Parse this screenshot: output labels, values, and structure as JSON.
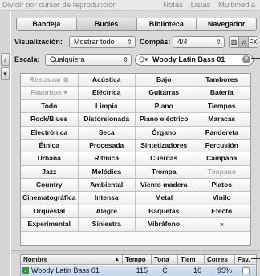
{
  "topbar": {
    "left_text": "Dividir por cursor de reproducción",
    "right_text": "Notas Listas Multimedia"
  },
  "tabs": [
    "Bandeja",
    "Bucles",
    "Biblioteca",
    "Navegador"
  ],
  "active_tab": "Bucles",
  "controls": {
    "view_label": "Visualización:",
    "view_value": "Mostrar todo",
    "time_label": "Compás:",
    "time_value": "4/4",
    "scale_label": "Escala:",
    "scale_value": "Cualquiera",
    "search_value": "Woody Latin Bass 01",
    "view_buttons": [
      "column-view-icon",
      "music-note-icon",
      "fx-icon"
    ],
    "fx_label": "FX"
  },
  "keywords": [
    "Restaurar",
    "Acústica",
    "Bajo",
    "Tambores",
    "Favoritos",
    "Eléctrica",
    "Guitarras",
    "Batería",
    "Todo",
    "Limpia",
    "Piano",
    "Tiempos",
    "Rock/Blues",
    "Distorsionada",
    "Piano eléctrico",
    "Maracas",
    "Electrónica",
    "Seca",
    "Órgano",
    "Pandereta",
    "Étnica",
    "Procesada",
    "Sintetizadores",
    "Percusión",
    "Urbana",
    "Rítmica",
    "Cuerdas",
    "Campana",
    "Jazz",
    "Melódica",
    "Trompa",
    "Tímpano",
    "Country",
    "Ambiental",
    "Viento madera",
    "Platos",
    "Cinematográfica",
    "Intensa",
    "Metal",
    "Vinilo",
    "Orquestal",
    "Alegre",
    "Baquetas",
    "Efecto",
    "Experimental",
    "Siniestra",
    "Vibráfono",
    "»"
  ],
  "dimmed_keywords": [
    "Restaurar",
    "Favoritos",
    "Tímpano"
  ],
  "table": {
    "headers": [
      "Nombre",
      "Tempo",
      "Tona",
      "Tiem",
      "Corres",
      "Fav."
    ],
    "rows": [
      {
        "name": "Woody Latin Bass 01",
        "tempo": "115",
        "key": "C",
        "beats": "16",
        "match": "95%",
        "fav": false
      }
    ]
  }
}
